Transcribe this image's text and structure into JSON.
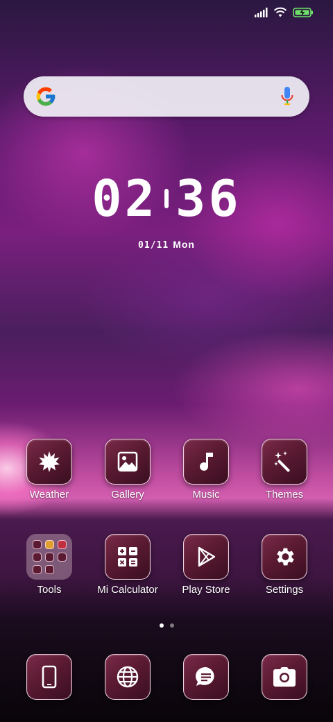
{
  "status_bar": {
    "icons": [
      "signal-icon",
      "wifi-icon",
      "battery-charging-icon"
    ],
    "battery_color": "#6ee06a"
  },
  "search_bar": {
    "logo": "google-g-icon",
    "mic": "mic-icon"
  },
  "clock": {
    "hours": "02",
    "minutes": "36",
    "date": "01/11",
    "weekday": "Mon"
  },
  "home_apps": [
    {
      "label": "Weather",
      "icon": "weather-icon"
    },
    {
      "label": "Gallery",
      "icon": "gallery-icon"
    },
    {
      "label": "Music",
      "icon": "music-icon"
    },
    {
      "label": "Themes",
      "icon": "themes-icon"
    },
    {
      "label": "Tools",
      "icon": "folder-icon"
    },
    {
      "label": "Mi Calculator",
      "icon": "calculator-icon"
    },
    {
      "label": "Play Store",
      "icon": "play-store-icon"
    },
    {
      "label": "Settings",
      "icon": "gear-icon"
    }
  ],
  "page_indicator": {
    "pages": 2,
    "current": 1
  },
  "dock": [
    {
      "icon": "phone-icon"
    },
    {
      "icon": "browser-globe-icon"
    },
    {
      "icon": "messages-icon"
    },
    {
      "icon": "camera-icon"
    }
  ],
  "colors": {
    "icon_bg": "#5a1a32",
    "icon_border": "#ffe1f0"
  }
}
